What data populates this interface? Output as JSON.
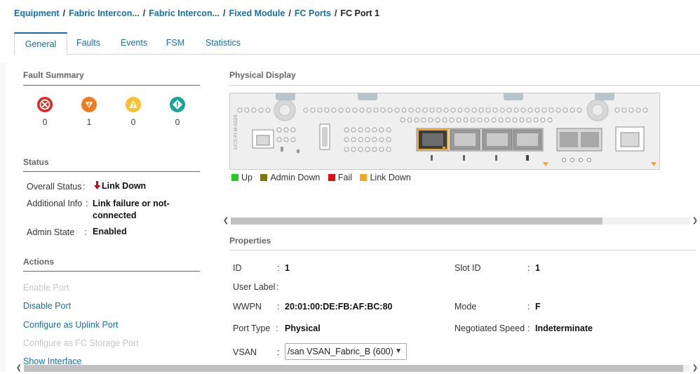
{
  "breadcrumb": {
    "items": [
      "Equipment",
      "Fabric Intercon...",
      "Fabric Intercon...",
      "Fixed Module",
      "FC Ports"
    ],
    "current": "FC Port 1",
    "separator": "/"
  },
  "tabs": [
    {
      "label": "General",
      "active": true
    },
    {
      "label": "Faults",
      "active": false
    },
    {
      "label": "Events",
      "active": false
    },
    {
      "label": "FSM",
      "active": false
    },
    {
      "label": "Statistics",
      "active": false
    }
  ],
  "fault_summary": {
    "title": "Fault Summary",
    "items": [
      {
        "icon": "critical-icon",
        "color": "#e2231a",
        "count": "0"
      },
      {
        "icon": "major-icon",
        "color": "#f07b1f",
        "count": "1"
      },
      {
        "icon": "minor-icon",
        "color": "#fbc02d",
        "count": "0"
      },
      {
        "icon": "warning-icon",
        "color": "#17a598",
        "count": "0"
      }
    ]
  },
  "status": {
    "title": "Status",
    "overall_label": "Overall Status",
    "overall_value": "Link Down",
    "overall_icon": "arrow-down-icon",
    "additional_label": "Additional Info",
    "additional_value_line1": "Link failure or not-",
    "additional_value_line2": "connected",
    "admin_label": "Admin State",
    "admin_value": "Enabled",
    "colon": ":"
  },
  "actions": {
    "title": "Actions",
    "items": [
      {
        "label": "Enable Port",
        "enabled": false
      },
      {
        "label": "Disable Port",
        "enabled": true
      },
      {
        "label": "Configure as Uplink Port",
        "enabled": true
      },
      {
        "label": "Configure as FC Storage Port",
        "enabled": false
      },
      {
        "label": "Show Interface",
        "enabled": true
      }
    ]
  },
  "physical_display": {
    "title": "Physical Display",
    "module_label": "UCS-FI-M-6324",
    "legend": [
      {
        "label": "Up",
        "color": "#22cc22"
      },
      {
        "label": "Admin Down",
        "color": "#7a7a00"
      },
      {
        "label": "Fail",
        "color": "#e01010"
      },
      {
        "label": "Link Down",
        "color": "#f5a623"
      }
    ]
  },
  "properties": {
    "title": "Properties",
    "id_label": "ID",
    "id_value": "1",
    "slot_label": "Slot ID",
    "slot_value": "1",
    "user_label_label": "User Label",
    "user_label_value": "",
    "wwpn_label": "WWPN",
    "wwpn_value": "20:01:00:DE:FB:AF:BC:80",
    "mode_label": "Mode",
    "mode_value": "F",
    "port_type_label": "Port Type",
    "port_type_value": "Physical",
    "speed_label": "Negotiated Speed",
    "speed_value": "Indeterminate",
    "vsan_label": "VSAN",
    "vsan_value": "/san VSAN_Fabric_B (600)",
    "colon": ":"
  },
  "colors": {
    "link": "#1a6ea8",
    "disabled": "#c3c7cb",
    "selected_port": "#f5a623"
  }
}
